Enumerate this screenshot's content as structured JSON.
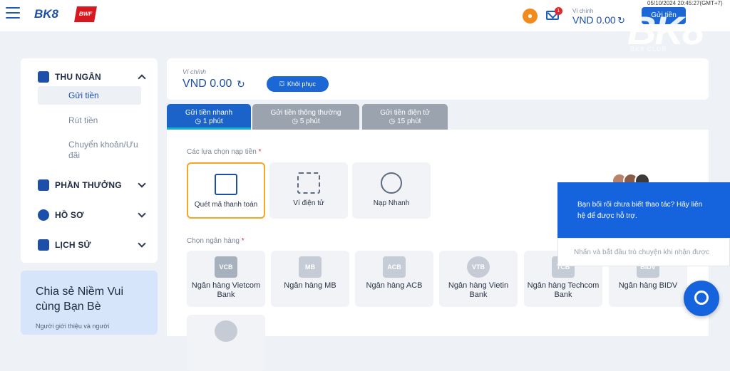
{
  "header": {
    "logo": "BK8",
    "partner_logo": "BWF",
    "datetime": "05/10/2024 20:45:27(GMT+7)",
    "mail_badge": "1",
    "wallet_label": "Ví chính",
    "wallet_value": "VND 0.00",
    "deposit_button": "Gửi tiền",
    "big_logo": "BK8",
    "big_logo_sub": "BK8 CLUB"
  },
  "sidebar": {
    "cashier": "THU NGÂN",
    "deposit": "Gửi tiền",
    "withdraw": "Rút tiền",
    "transfer": "Chuyển khoản/Ưu đãi",
    "rewards": "PHẦN THƯỞNG",
    "profile": "HỒ SƠ",
    "history": "LỊCH SỬ"
  },
  "share": {
    "title": "Chia sẻ Niềm Vui cùng Bạn Bè",
    "text": "Người giới thiệu và người"
  },
  "wallet": {
    "label": "Ví chính",
    "value": "VND 0.00",
    "restore_button": "Khôi phục"
  },
  "tabs": [
    {
      "label": "Gửi tiền nhanh",
      "time": "1 phút"
    },
    {
      "label": "Gửi tiền thông thường",
      "time": "5 phút"
    },
    {
      "label": "Gửi tiền điện tử",
      "time": "15 phút"
    }
  ],
  "deposit_options_label": "Các lựa chọn nạp tiền",
  "methods": [
    "Quét mã thanh toán",
    "Ví điện tử",
    "Nạp Nhanh"
  ],
  "bank_label": "Chọn ngân hàng",
  "banks": [
    {
      "name": "Ngân hàng Vietcom Bank",
      "code": "VCB"
    },
    {
      "name": "Ngân hàng MB",
      "code": "MB"
    },
    {
      "name": "Ngân hàng ACB",
      "code": "ACB"
    },
    {
      "name": "Ngân hàng Vietin Bank",
      "code": "VTB"
    },
    {
      "name": "Ngân hàng Techcom Bank",
      "code": "TCB"
    },
    {
      "name": "Ngân hàng BIDV",
      "code": "BIDV"
    }
  ],
  "chat": {
    "message": "Bạn bối rối chưa biết thao tác? Hãy liên hệ để được hỗ trợ.",
    "input_placeholder": "Nhấn và bắt đầu trò chuyện khi nhận được"
  }
}
